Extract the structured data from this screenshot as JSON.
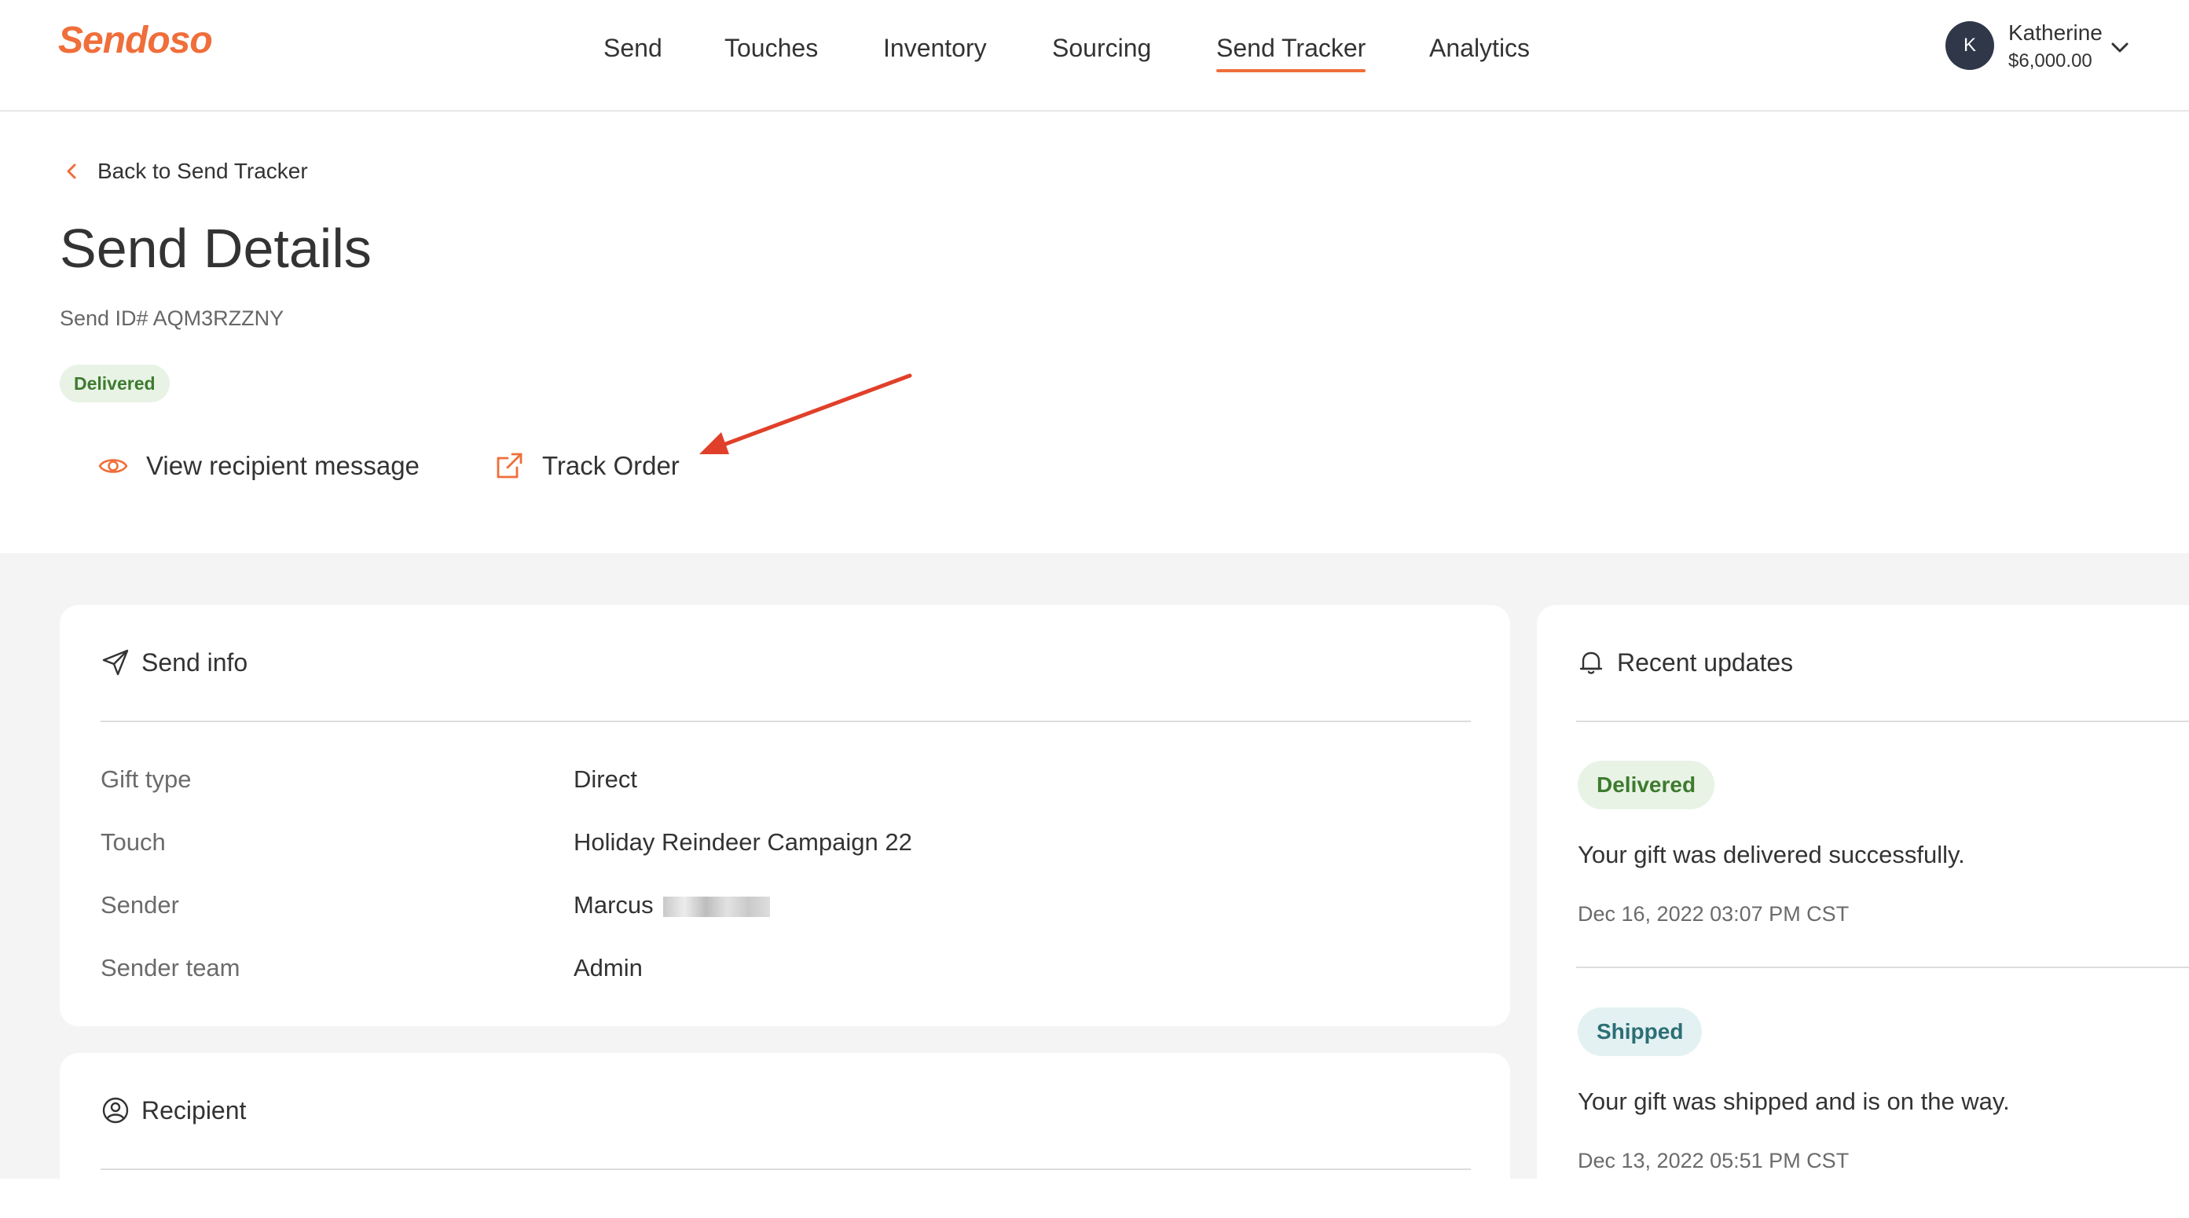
{
  "header": {
    "logo": "Sendoso",
    "nav": [
      {
        "label": "Send",
        "active": false
      },
      {
        "label": "Touches",
        "active": false
      },
      {
        "label": "Inventory",
        "active": false
      },
      {
        "label": "Sourcing",
        "active": false
      },
      {
        "label": "Send Tracker",
        "active": true
      },
      {
        "label": "Analytics",
        "active": false
      }
    ],
    "user": {
      "initial": "K",
      "name": "Katherine",
      "balance": "$6,000.00"
    }
  },
  "page": {
    "back_label": "Back to Send Tracker",
    "title": "Send Details",
    "send_id": "Send ID# AQM3RZZNY",
    "status": "Delivered",
    "actions": {
      "view_message": "View recipient message",
      "track_order": "Track Order"
    }
  },
  "send_info": {
    "title": "Send info",
    "rows": [
      {
        "label": "Gift type",
        "value": "Direct"
      },
      {
        "label": "Touch",
        "value": "Holiday Reindeer Campaign 22"
      },
      {
        "label": "Sender",
        "value": "Marcus"
      },
      {
        "label": "Sender team",
        "value": "Admin"
      }
    ]
  },
  "recipient": {
    "title": "Recipient"
  },
  "recent_updates": {
    "title": "Recent updates",
    "items": [
      {
        "status": "Delivered",
        "message": "Your gift was delivered successfully.",
        "time": "Dec 16, 2022 03:07 PM CST"
      },
      {
        "status": "Shipped",
        "message": "Your gift was shipped and is on the way.",
        "time": "Dec 13, 2022 05:51 PM CST"
      }
    ]
  },
  "colors": {
    "accent": "#ef6e3a",
    "annotation_arrow": "#e0402a",
    "delivered_bg": "#e8f3e6",
    "delivered_text": "#3e7b2e",
    "shipped_bg": "#e3f1f2",
    "shipped_text": "#2c6e75",
    "avatar_bg": "#2f3749",
    "page_bg_gray": "#f4f4f4"
  }
}
